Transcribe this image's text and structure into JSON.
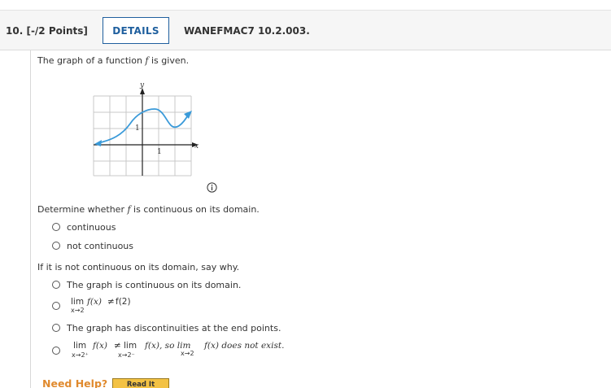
{
  "header": {
    "question_number": "10.",
    "points": "[-/2 Points]",
    "details_label": "DETAILS",
    "question_id": "WANEFMAC7 10.2.003."
  },
  "intro": {
    "prefix": "The graph of a function ",
    "f": "f",
    "suffix": " is given."
  },
  "graph": {
    "y_axis": "y",
    "x_axis": "x",
    "y_tick": "1",
    "x_tick": "1"
  },
  "question1": {
    "prefix": "Determine whether ",
    "f": "f",
    "suffix": " is continuous on its domain.",
    "options": [
      "continuous",
      "not continuous"
    ]
  },
  "question2": {
    "prompt": "If it is not continuous on its domain, say why.",
    "option1": "The graph is continuous on its domain.",
    "option2": {
      "lim": "lim",
      "fx": "f(x)",
      "neq": "≠",
      "f2": "f(2)",
      "sub": "x→2"
    },
    "option3": "The graph has discontinuities at the end points.",
    "option4": {
      "lim1": "lim",
      "fx1": "f(x)",
      "neq": "≠",
      "lim2": "lim",
      "fx2": "f(x), so lim",
      "fx3": "f(x) does not exist.",
      "sub1": "x→2⁺",
      "sub2": "x→2⁻",
      "sub3": "x→2"
    }
  },
  "help": {
    "need_help": "Need Help?",
    "read_it": "Read It"
  }
}
